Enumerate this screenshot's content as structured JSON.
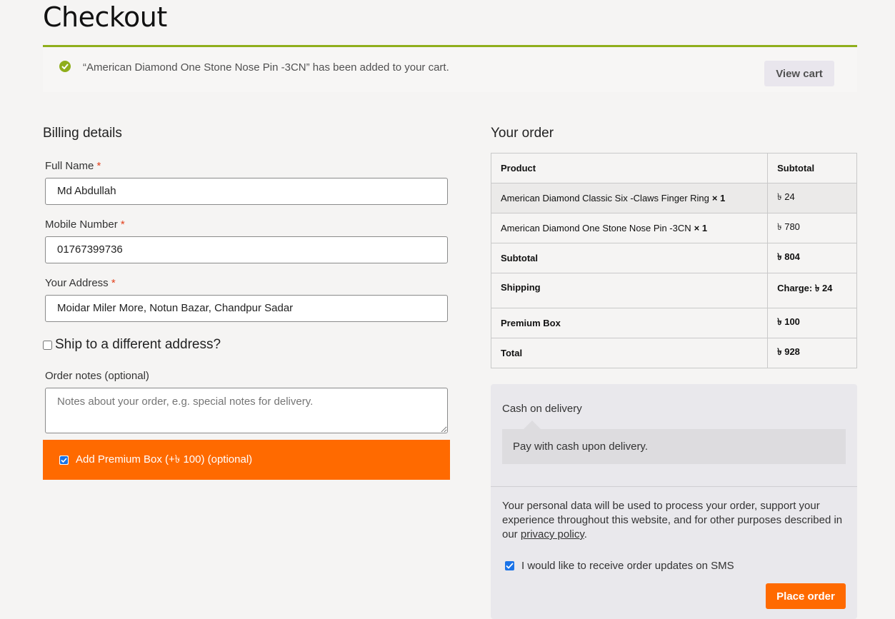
{
  "page": {
    "title": "Checkout"
  },
  "notice": {
    "message": "“American Diamond One Stone Nose Pin -3CN” has been added to your cart.",
    "button": "View cart",
    "accent": "#8fae1b"
  },
  "billing": {
    "title": "Billing details",
    "fields": [
      {
        "label": "Full Name",
        "required": "*",
        "value": "Md Abdullah"
      },
      {
        "label": "Mobile Number",
        "required": "*",
        "value": "01767399736"
      },
      {
        "label": "Your Address",
        "required": "*",
        "value": "Moidar Miler More, Notun Bazar, Chandpur Sadar"
      }
    ],
    "ship_different": {
      "label": "Ship to a different address?",
      "checked": false
    },
    "notes": {
      "label": "Order notes (optional)",
      "placeholder": "Notes about your order, e.g. special notes for delivery."
    },
    "premium_box": {
      "label": "Add Premium Box (+৳ 100) (optional)",
      "checked": true,
      "color": "#ff6a00"
    }
  },
  "order": {
    "title": "Your order",
    "headers": {
      "product": "Product",
      "subtotal": "Subtotal"
    },
    "items": [
      {
        "name": "American Diamond Classic Six -Claws Finger Ring",
        "qty": "× 1",
        "price": "৳ 24"
      },
      {
        "name": "American Diamond One Stone Nose Pin -3CN",
        "qty": "× 1",
        "price": "৳ 780"
      }
    ],
    "totals": [
      {
        "label": "Subtotal",
        "value": "৳ 804"
      },
      {
        "label": "Shipping",
        "value": "Charge: ৳ 24"
      },
      {
        "label": "Premium Box",
        "value": "৳ 100"
      },
      {
        "label": "Total",
        "value": "৳ 928"
      }
    ]
  },
  "payment": {
    "method": "Cash on delivery",
    "description": "Pay with cash upon delivery.",
    "privacy_text": "Your personal data will be used to process your order, support your experience throughout this website, and for other purposes described in our",
    "privacy_link": "privacy policy",
    "privacy_end": ".",
    "sms": {
      "label": "I would like to receive order updates on SMS",
      "checked": true
    },
    "place_order": "Place order"
  }
}
